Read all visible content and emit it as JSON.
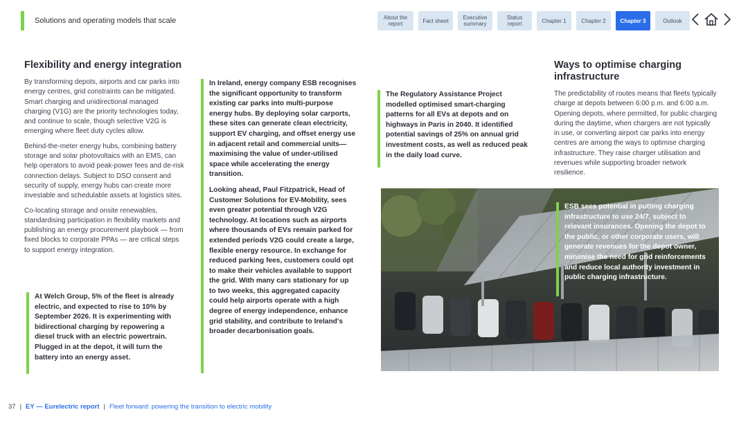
{
  "header": {
    "section_title": "Solutions and operating models that scale",
    "tabs": [
      {
        "label": "About the report",
        "width": 52
      },
      {
        "label": "Fact sheet",
        "width": 50
      },
      {
        "label": "Executive summary",
        "width": 50
      },
      {
        "label": "Status report",
        "width": 50
      },
      {
        "label": "Chapter 1",
        "width": 50
      },
      {
        "label": "Chapter 2",
        "width": 50
      },
      {
        "label": "Chapter 3",
        "width": 50,
        "active": true
      },
      {
        "label": "Outlook",
        "width": 50
      }
    ]
  },
  "col1": {
    "heading": "Flexibility and energy integration",
    "paragraphs": [
      "By transforming depots, airports and car parks into energy centres, grid constraints can be mitigated. Smart charging and unidirectional managed charging (V1G) are the priority technologies today, and continue to scale, though selective V2G is emerging where fleet duty cycles allow.",
      "Behind-the-meter energy hubs, combining battery storage and solar photovoltaics with an EMS, can help operators to avoid peak-power fees and de-risk connection delays. Subject to DSO consent and security of supply, energy hubs can create more investable and schedulable assets at logistics sites.",
      "Co-locating storage and onsite renewables, standardising participation in flexibility markets and publishing an energy procurement playbook — from fixed blocks to corporate PPAs — are critical steps to support energy integration."
    ],
    "quote": "At Welch Group, 5% of the fleet is already electric, and expected to rise to 10% by September 2026. It is experimenting with bidirectional charging by repowering a diesel truck with an electric powertrain. Plugged in at the depot, it will turn the battery into an energy asset."
  },
  "col2": {
    "paragraphs": [
      "In Ireland, energy company ESB recognises the significant opportunity to transform existing car parks into multi-purpose energy hubs. By deploying solar carports, these sites can generate clean electricity, support EV charging, and offset energy use in adjacent retail and commercial units—maximising the value of under-utilised space while accelerating the energy transition.",
      "Looking ahead, Paul Fitzpatrick, Head of Customer Solutions for EV-Mobility, sees even greater potential through V2G technology. At locations such as airports where thousands of EVs remain parked for extended periods V2G could create a large, flexible energy resource. In exchange for reduced parking fees, customers could opt to make their vehicles available to support the grid. With many cars stationary for up to two weeks, this aggregated capacity could help airports operate with a high degree of energy independence, enhance grid stability, and contribute to Ireland's broader decarbonisation goals."
    ]
  },
  "col3": {
    "quote": "The Regulatory Assistance Project modelled optimised smart-charging patterns for all EVs at depots and on highways in Paris in 2040. It identified potential savings of 25% on annual grid investment costs, as well as reduced peak in the daily load curve.",
    "photo_quote": "ESB sees potential in putting charging infrastructure to use 24/7, subject to relevant insurances. Opening the depot to the public, or other corporate users, will generate revenues for the depot owner, minimise the need for grid reinforcements and reduce local authority investment in public charging infrastructure."
  },
  "col4": {
    "heading": "Ways to optimise charging infrastructure",
    "paragraph": "The predictability of routes means that fleets typically charge at depots between 6:00 p.m. and 6:00 a.m. Opening depots, where permitted, for public charging during the daytime, when chargers are not typically in use, or converting airport car parks into energy centres are among the ways to optimise charging infrastructure. They raise charger utilisation and revenues while supporting broader network resilience."
  },
  "footer": {
    "page_number": "37",
    "brand": "EY — Eurelectric report",
    "subtitle": "Fleet forward: powering the transition to electric mobility"
  },
  "icons": [
    "chevron-left-icon",
    "home-icon",
    "chevron-right-icon"
  ],
  "colors": {
    "accent_green": "#7dd14f",
    "accent_blue": "#2b6de8",
    "tab_bg": "#d9e6f2"
  }
}
